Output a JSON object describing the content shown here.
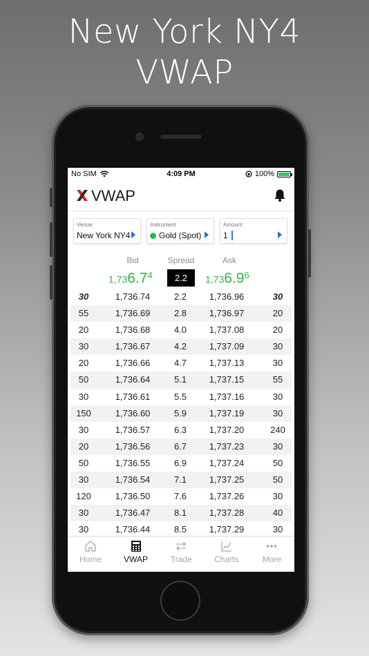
{
  "promo": {
    "line1": "New York NY4",
    "line2": "VWAP"
  },
  "status_bar": {
    "carrier": "No SIM",
    "time": "4:09 PM",
    "battery": "100%"
  },
  "header": {
    "title": "VWAP",
    "icons": {
      "logo": "x-logo",
      "notifications": "bell-icon"
    }
  },
  "selectors": {
    "venue": {
      "label": "Venue",
      "value": "New York NY4"
    },
    "instrument": {
      "label": "Instrument",
      "value": "Gold (Spot)",
      "status_color": "#2db84b"
    },
    "amount": {
      "label": "Amount",
      "value": "1"
    }
  },
  "table": {
    "headers": {
      "bid": "Bid",
      "spread": "Spread",
      "ask": "Ask"
    },
    "best": {
      "bid_small": "1,73",
      "bid_large": "6.7",
      "bid_pip": "4",
      "spread": "2.2",
      "ask_small": "1,73",
      "ask_large": "6.9",
      "ask_pip": "6"
    },
    "rows": [
      {
        "bid_size": "30",
        "bid": "1,736.74",
        "spread": "2.2",
        "ask": "1,736.96",
        "ask_size": "30"
      },
      {
        "bid_size": "55",
        "bid": "1,736.69",
        "spread": "2.8",
        "ask": "1,736.97",
        "ask_size": "20"
      },
      {
        "bid_size": "20",
        "bid": "1,736.68",
        "spread": "4.0",
        "ask": "1,737.08",
        "ask_size": "20"
      },
      {
        "bid_size": "30",
        "bid": "1,736.67",
        "spread": "4.2",
        "ask": "1,737.09",
        "ask_size": "30"
      },
      {
        "bid_size": "20",
        "bid": "1,736.66",
        "spread": "4.7",
        "ask": "1,737.13",
        "ask_size": "30"
      },
      {
        "bid_size": "50",
        "bid": "1,736.64",
        "spread": "5.1",
        "ask": "1,737.15",
        "ask_size": "55"
      },
      {
        "bid_size": "30",
        "bid": "1,736.61",
        "spread": "5.5",
        "ask": "1,737.16",
        "ask_size": "30"
      },
      {
        "bid_size": "150",
        "bid": "1,736.60",
        "spread": "5.9",
        "ask": "1,737.19",
        "ask_size": "30"
      },
      {
        "bid_size": "30",
        "bid": "1,736.57",
        "spread": "6.3",
        "ask": "1,737.20",
        "ask_size": "240"
      },
      {
        "bid_size": "20",
        "bid": "1,736.56",
        "spread": "6.7",
        "ask": "1,737.23",
        "ask_size": "30"
      },
      {
        "bid_size": "50",
        "bid": "1,736.55",
        "spread": "6.9",
        "ask": "1,737.24",
        "ask_size": "50"
      },
      {
        "bid_size": "30",
        "bid": "1,736.54",
        "spread": "7.1",
        "ask": "1,737.25",
        "ask_size": "50"
      },
      {
        "bid_size": "120",
        "bid": "1,736.50",
        "spread": "7.6",
        "ask": "1,737.26",
        "ask_size": "30"
      },
      {
        "bid_size": "30",
        "bid": "1,736.47",
        "spread": "8.1",
        "ask": "1,737.28",
        "ask_size": "40"
      },
      {
        "bid_size": "30",
        "bid": "1,736.44",
        "spread": "8.5",
        "ask": "1,737.29",
        "ask_size": "30"
      }
    ]
  },
  "tabs": [
    {
      "label": "Home",
      "icon": "home-icon",
      "active": false
    },
    {
      "label": "VWAP",
      "icon": "calculator-icon",
      "active": true
    },
    {
      "label": "Trade",
      "icon": "transfer-icon",
      "active": false
    },
    {
      "label": "Charts",
      "icon": "chart-icon",
      "active": false
    },
    {
      "label": "More",
      "icon": "more-icon",
      "active": false
    }
  ],
  "colors": {
    "price_green": "#33b04a",
    "accent_blue": "#1c6fe0",
    "logo_red": "#d6281f"
  }
}
